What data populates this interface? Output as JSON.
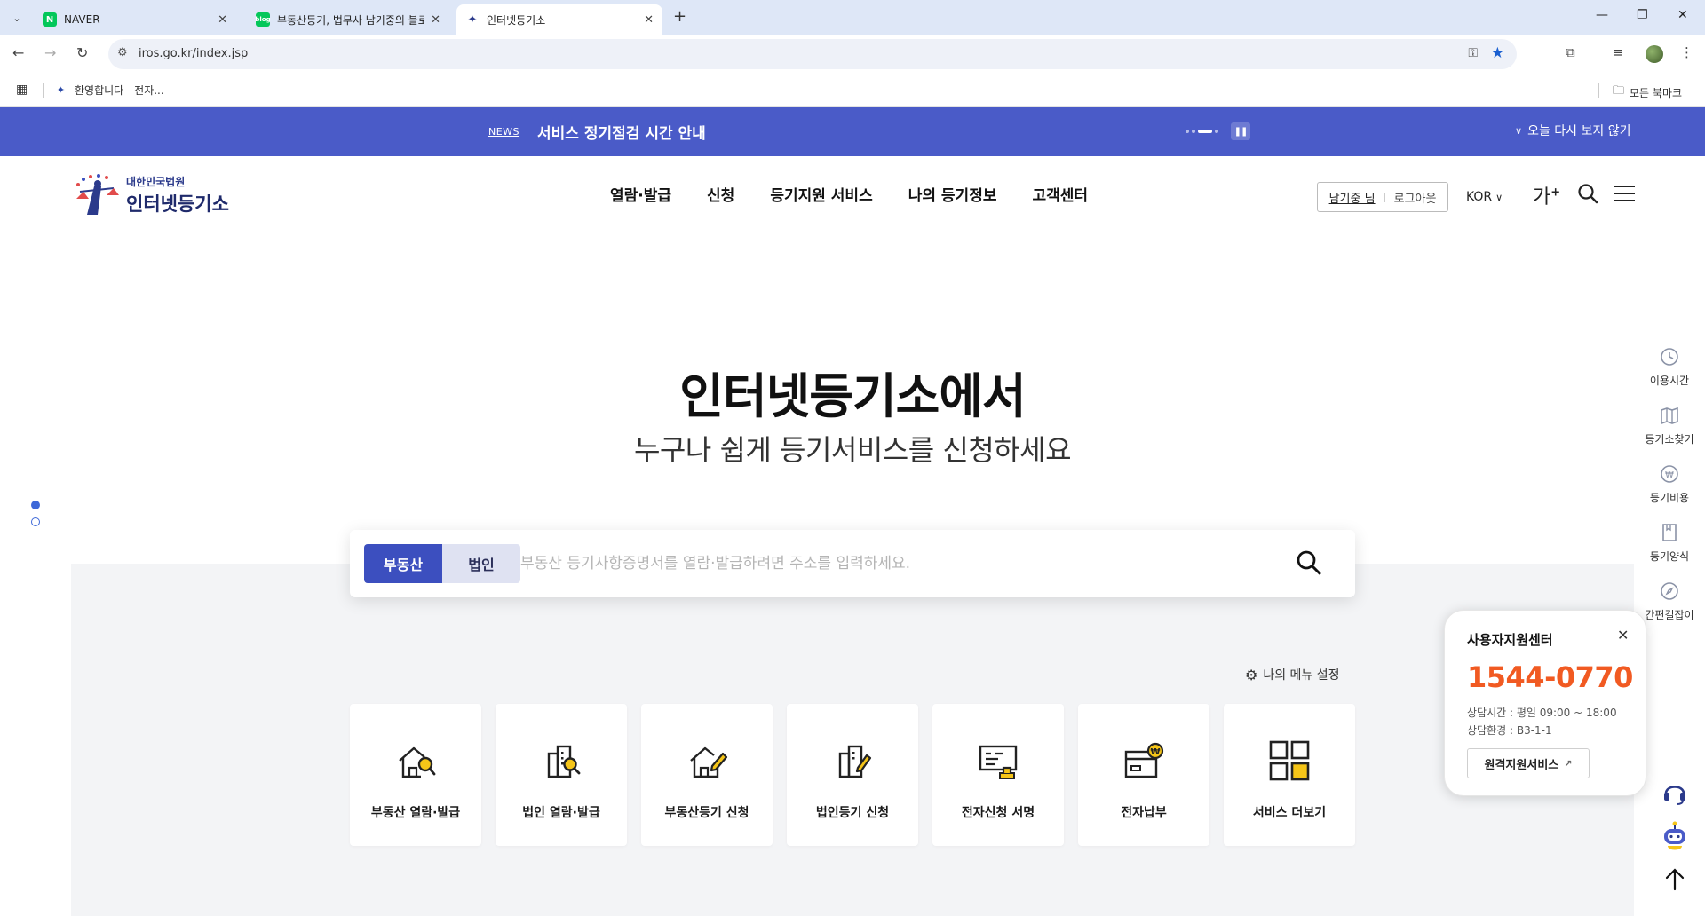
{
  "browser": {
    "tabs": [
      {
        "title": "NAVER",
        "favicon": "naver-icon",
        "active": false
      },
      {
        "title": "부동산등기, 법무사 남기중의 블로그",
        "favicon": "blog-icon",
        "active": false
      },
      {
        "title": "인터넷등기소",
        "favicon": "iros-icon",
        "active": true
      }
    ],
    "url": "iros.go.kr/index.jsp",
    "bookmark_item": "환영합니다 - 전자...",
    "all_bookmarks": "모든 북마크"
  },
  "news": {
    "tag": "NEWS",
    "text": "서비스 정기점검 시간 안내",
    "dismiss": "오늘 다시 보지 않기"
  },
  "header": {
    "logo_sub": "대한민국법원",
    "logo_main": "인터넷등기소",
    "nav": [
      "열람·발급",
      "신청",
      "등기지원 서비스",
      "나의 등기정보",
      "고객센터"
    ],
    "user_name": "남기중 님",
    "logout": "로그아웃",
    "lang": "KOR",
    "fontsize": "가"
  },
  "hero": {
    "title": "인터넷등기소에서",
    "subtitle": "누구나 쉽게 등기서비스를 신청하세요"
  },
  "search": {
    "tabs": [
      "부동산",
      "법인"
    ],
    "placeholder": "부동산 등기사항증명서를 열람·발급하려면 주소를 입력하세요."
  },
  "my_menu": "나의 메뉴 설정",
  "services": [
    {
      "label": "부동산 열람·발급",
      "icon": "house-search-icon"
    },
    {
      "label": "법인 열람·발급",
      "icon": "building-search-icon"
    },
    {
      "label": "부동산등기 신청",
      "icon": "house-pen-icon"
    },
    {
      "label": "법인등기 신청",
      "icon": "building-pen-icon"
    },
    {
      "label": "전자신청 서명",
      "icon": "document-sign-icon"
    },
    {
      "label": "전자납부",
      "icon": "card-payment-icon"
    },
    {
      "label": "서비스 더보기",
      "icon": "grid-more-icon"
    }
  ],
  "quick": [
    {
      "label": "이용시간",
      "icon": "clock-icon"
    },
    {
      "label": "등기소찾기",
      "icon": "map-icon"
    },
    {
      "label": "등기비용",
      "icon": "won-coin-icon"
    },
    {
      "label": "등기양식",
      "icon": "form-icon"
    },
    {
      "label": "간편길잡이",
      "icon": "compass-icon"
    }
  ],
  "support": {
    "title": "사용자지원센터",
    "phone": "1544-0770",
    "hours": "상담시간 : 평일 09:00 ~ 18:00",
    "env": "상담환경 : B3-1-1",
    "remote": "원격지원서비스"
  },
  "colors": {
    "brand_blue": "#3c4fbf",
    "news_bg": "#4a5bc8",
    "accent_orange": "#f15a22",
    "icon_yellow": "#f5c518"
  }
}
